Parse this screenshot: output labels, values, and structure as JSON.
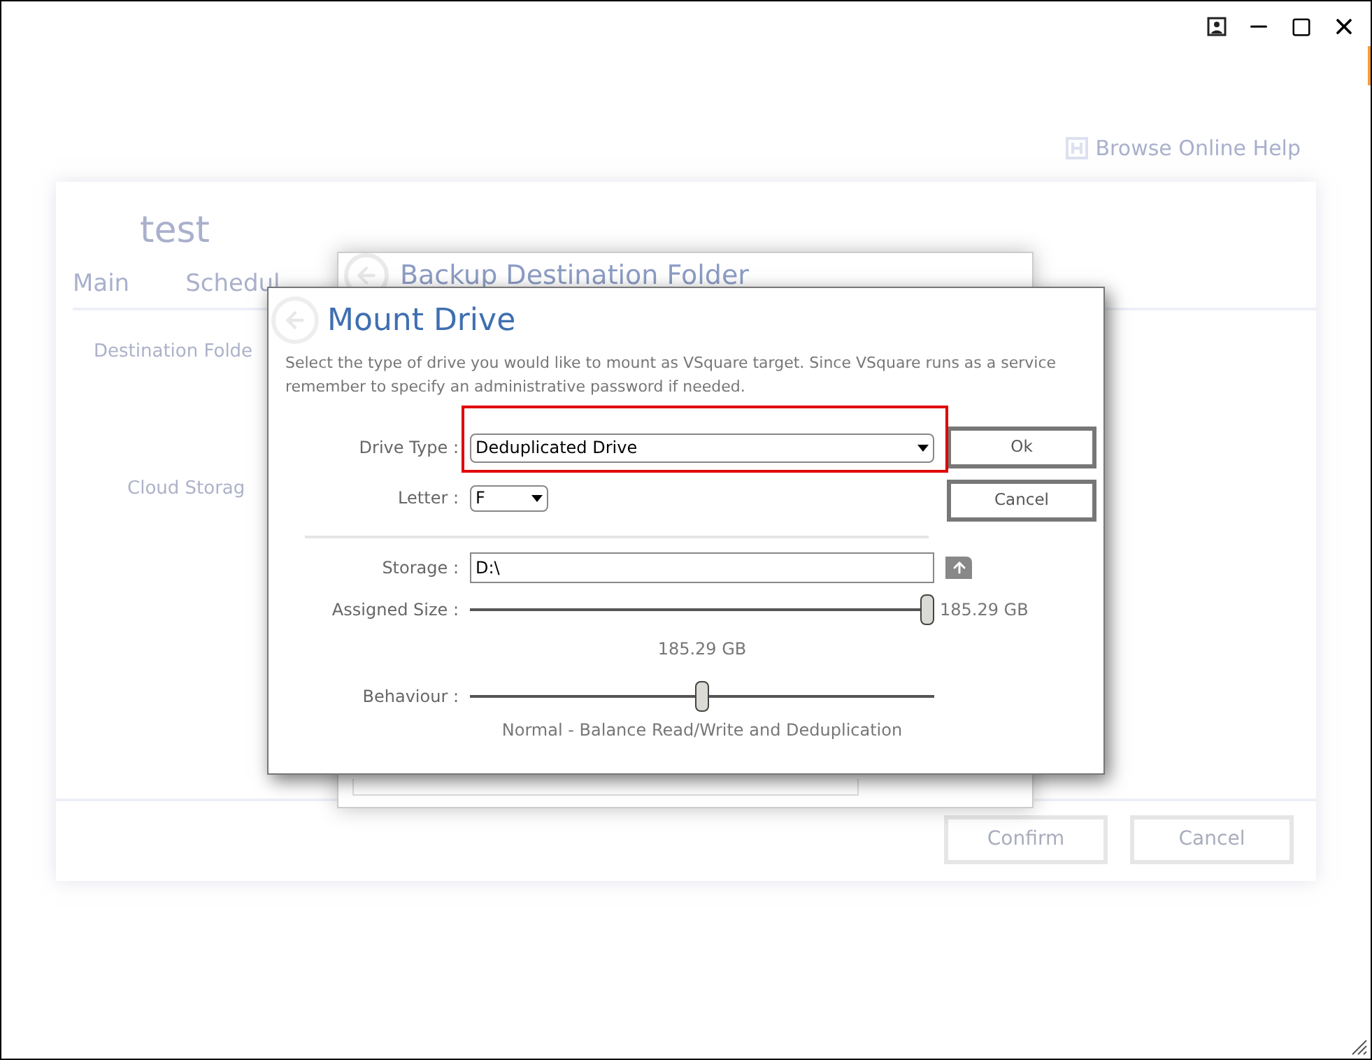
{
  "window": {
    "help_link": "Browse Online Help"
  },
  "background": {
    "title": "test",
    "tabs": [
      {
        "label": "Main"
      },
      {
        "label": "Schedul"
      }
    ],
    "fields": [
      "Destination Folde",
      "Cloud Storag"
    ],
    "buttons": [
      "Confirm",
      "Cancel"
    ]
  },
  "backup_dialog": {
    "title": "Backup Destination Folder"
  },
  "mount_dialog": {
    "title": "Mount Drive",
    "description": "Select the type of drive you would like to mount as VSquare target. Since VSquare runs as a service remember to specify an administrative password if needed.",
    "drive_type": {
      "label": "Drive Type :",
      "value": "Deduplicated Drive",
      "highlighted": true
    },
    "letter": {
      "label": "Letter :",
      "value": "F"
    },
    "storage": {
      "label": "Storage :",
      "value": "D:\\"
    },
    "assigned_size": {
      "label": "Assigned Size :",
      "level": 1,
      "reading": "185.29 GB",
      "caption": "185.29 GB"
    },
    "behaviour": {
      "label": "Behaviour :",
      "level": 0.5,
      "caption": "Normal - Balance Read/Write and Deduplication"
    },
    "buttons": [
      "Ok",
      "Cancel"
    ]
  }
}
